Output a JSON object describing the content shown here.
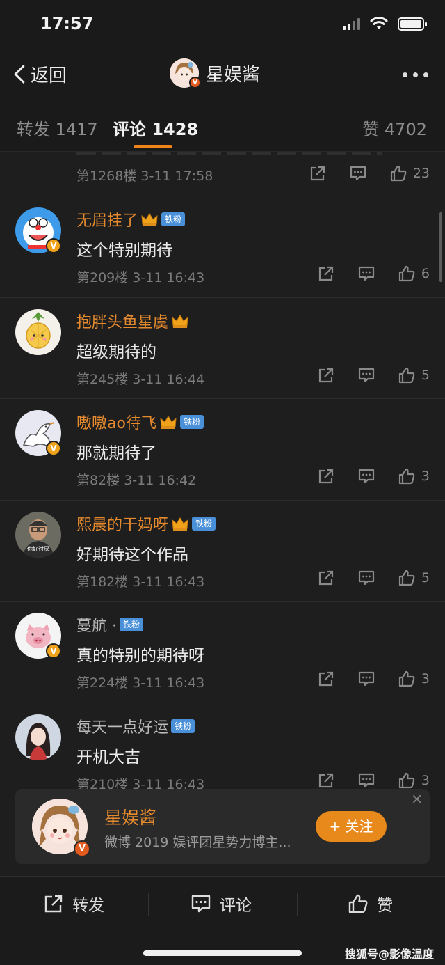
{
  "status_bar": {
    "time": "17:57"
  },
  "nav": {
    "back_label": "返回",
    "title": "星娱酱"
  },
  "tabs": [
    {
      "label": "转发 1417"
    },
    {
      "label": "评论 1428"
    },
    {
      "label": "赞 4702"
    }
  ],
  "partial_comment": {
    "meta": "第1268楼 3-11 17:58",
    "likes": "23"
  },
  "comments": [
    {
      "name": "无眉挂了",
      "badge": "铁粉",
      "text": "这个特别期待",
      "meta": "第209楼 3-11 16:43",
      "likes": "6"
    },
    {
      "name": "抱胖头鱼星虞",
      "badge": "",
      "text": "超级期待的",
      "meta": "第245楼 3-11 16:44",
      "likes": "5"
    },
    {
      "name": "嗷嗷ao待飞",
      "badge": "铁粉",
      "text": "那就期待了",
      "meta": "第82楼 3-11 16:42",
      "likes": "3"
    },
    {
      "name": "熙晨的干妈呀",
      "badge": "铁粉",
      "text": "好期待这个作品",
      "meta": "第182楼 3-11 16:43",
      "likes": "5",
      "avatar_caption": "你好讨厌"
    },
    {
      "name": "蔓航 ·",
      "badge": "铁粉",
      "text": "真的特别的期待呀",
      "meta": "第224楼 3-11 16:43",
      "likes": "3"
    },
    {
      "name": "每天一点好运",
      "badge": "铁粉",
      "text": "开机大吉",
      "meta": "第210楼 3-11 16:43",
      "likes": "3"
    }
  ],
  "follow_card": {
    "name": "星娱酱",
    "description": "微博 2019 娱评团星势力博主...",
    "follow_label": "+ 关注",
    "close": "×"
  },
  "bottom_bar": {
    "repost": "转发",
    "comment": "评论",
    "like": "赞"
  },
  "watermark": "搜狐号@影像温度",
  "colors": {
    "accent": "#e68a2e",
    "background": "#1e1e1e",
    "fan_badge": "#4a90d9"
  }
}
